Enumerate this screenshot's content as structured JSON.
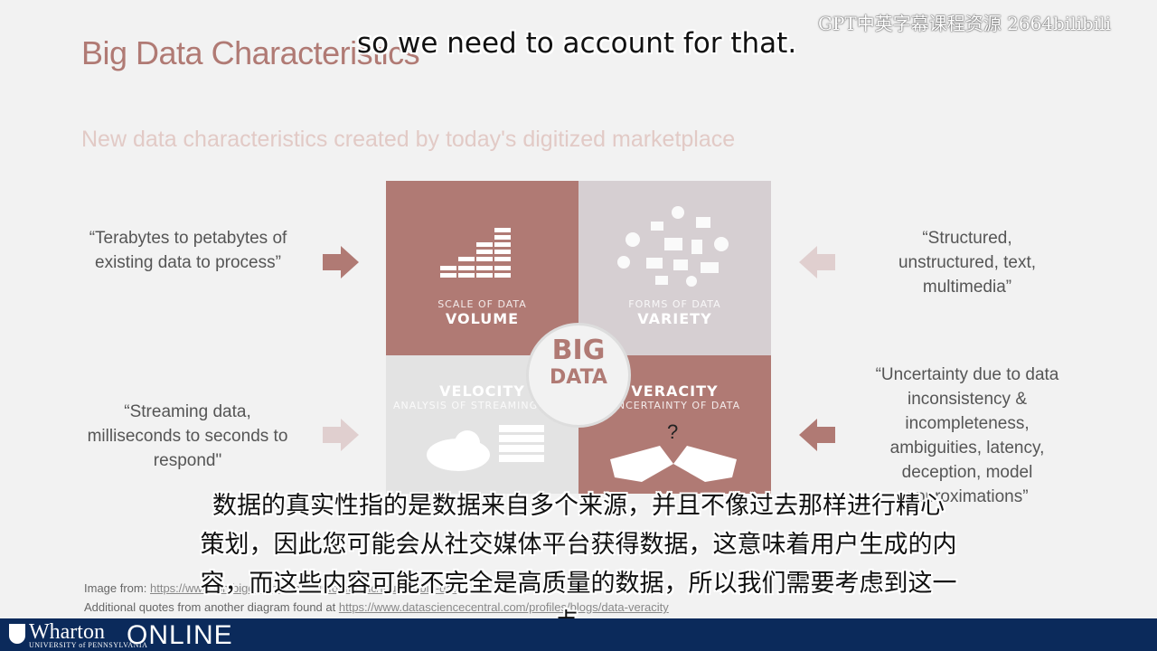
{
  "slide": {
    "title": "Big Data Characteristics",
    "subtitle": "New data characteristics created by today's digitized marketplace"
  },
  "watermark": "GPT中英字幕课程资源 2664bilibili",
  "subtitle_en": "so we need to account for that.",
  "subtitle_cn": [
    "数据的真实性指的是数据来自多个来源，并且不像过去那样进行精心",
    "策划，因此您可能会从社交媒体平台获得数据，这意味着用户生成的内",
    "容，而这些内容可能不完全是高质量的数据，所以我们需要考虑到这一",
    "点。"
  ],
  "quotes": {
    "volume": "“Terabytes to petabytes of existing data to process”",
    "variety": "“Structured, unstructured, text, multimedia”",
    "velocity": "“Streaming data, milliseconds to seconds to respond\"",
    "veracity": "“Uncertainty due to data inconsistency & incompleteness, ambiguities, latency, deception, model approximations”"
  },
  "diagram": {
    "center_line1": "BIG",
    "center_line2": "DATA",
    "volume_small": "SCALE OF DATA",
    "volume_big": "VOLUME",
    "variety_small": "FORMS OF DATA",
    "variety_big": "VARIETY",
    "velocity_big": "VELOCITY",
    "velocity_small": "ANALYSIS OF STREAMING DATA",
    "veracity_big": "VERACITY",
    "veracity_small": "UNCERTAINTY OF DATA",
    "question_mark": "?"
  },
  "credits": {
    "image_from_label": "Image from:",
    "image_from_link": "https://www.ibmbigdatahub.com/infographic/four-vs-big-data",
    "quotes_label": "Additional quotes from another diagram found at",
    "quotes_link": "https://www.datasciencecentral.com/profiles/blogs/data-veracity"
  },
  "footer": {
    "brand": "Wharton",
    "brand_sub": "UNIVERSITY of PENNSYLVANIA",
    "online": "ONLINE"
  },
  "colors": {
    "accent": "#b07a74",
    "variety_bg": "#d6cfd2",
    "velocity_bg": "#e3e3e3",
    "footer_bg": "#0b2a5b",
    "arrow": "#b07a74"
  }
}
